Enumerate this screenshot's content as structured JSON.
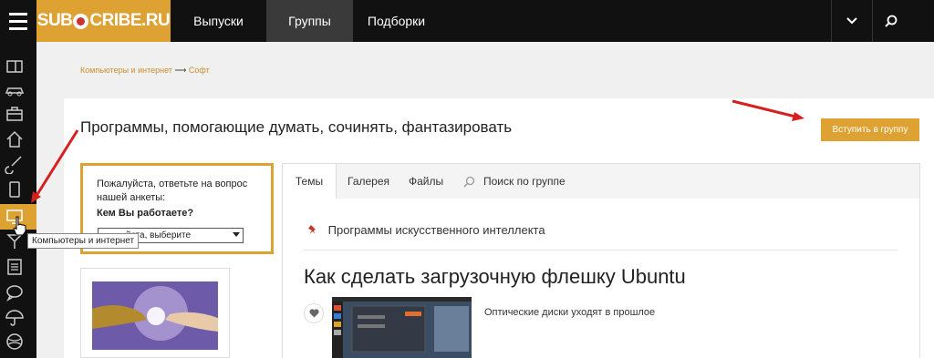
{
  "brand": {
    "logo_pre": "SUB",
    "logo_post": "CRIBE.RU"
  },
  "nav": {
    "items": [
      "Выпуски",
      "Группы",
      "Подборки"
    ],
    "active": "Группы"
  },
  "breadcrumb": {
    "parent": "Компьютеры и интернет",
    "arrow": "⟶",
    "current": "Софт"
  },
  "page": {
    "title": "Программы, помогающие думать, сочинять, фантазировать",
    "join_label": "Вступить в группу"
  },
  "poll": {
    "question": "Пожалуйста, ответьте на вопрос нашей анкеты:",
    "prompt": "Кем Вы работаете?",
    "select_value": "йста, выберите"
  },
  "tabs": {
    "items": [
      "Темы",
      "Галерея",
      "Файлы"
    ],
    "search_label": "Поиск по группе",
    "active": "Темы"
  },
  "topic": {
    "name": "Программы искусственного интеллекта"
  },
  "article": {
    "title": "Как сделать загрузочную флешку Ubuntu",
    "subtitle": "Оптические диски уходят в прошлое"
  },
  "tooltip": {
    "text": "Компьютеры и интернет"
  },
  "colors": {
    "accent": "#dea233",
    "dark": "#111111",
    "arrow": "#d62020"
  }
}
